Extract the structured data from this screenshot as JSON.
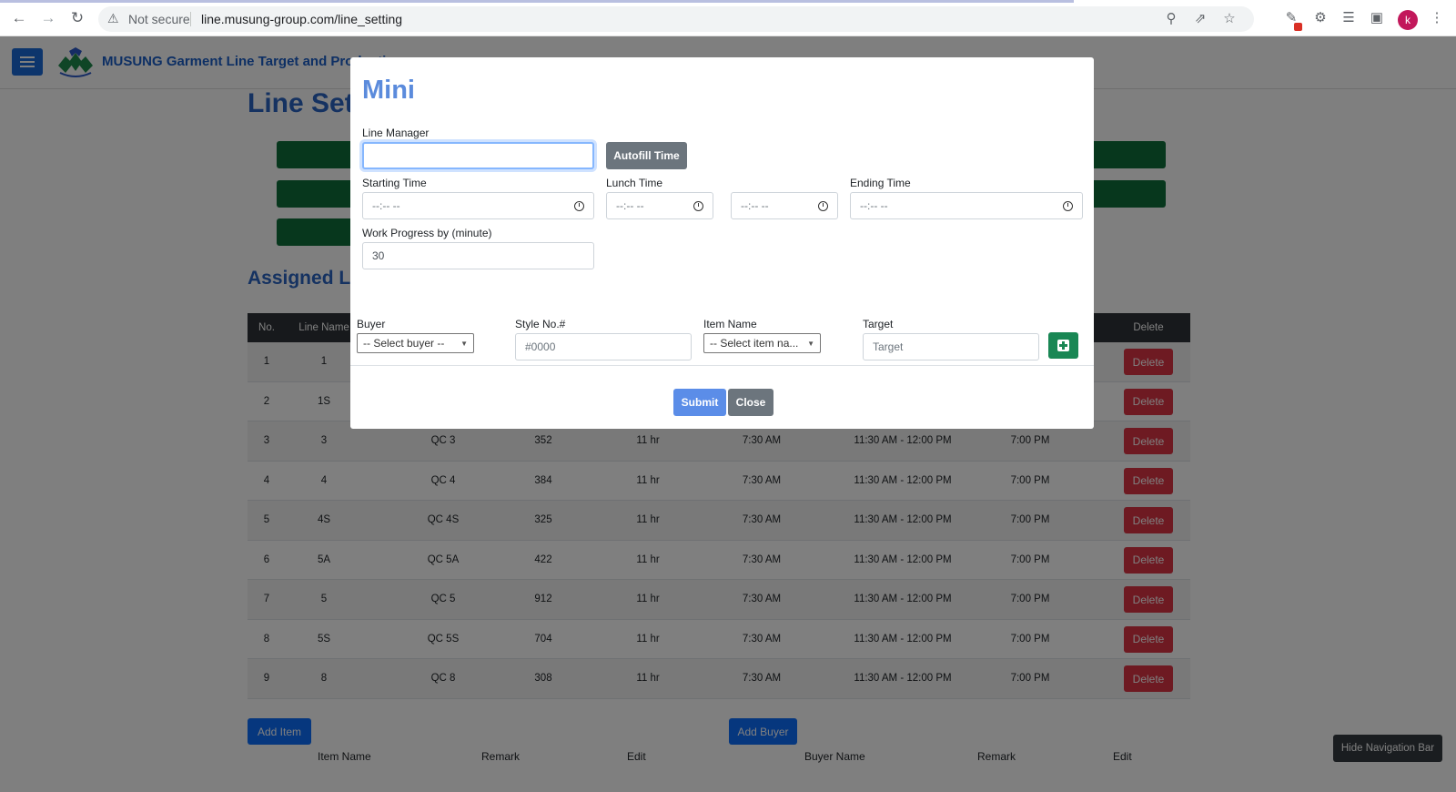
{
  "browser": {
    "security_label": "Not secure",
    "url": "line.musung-group.com/line_setting",
    "profile_initial": "k",
    "icons": [
      "back-icon",
      "forward-icon",
      "reload-icon",
      "warning-icon",
      "zoom-icon",
      "share-icon",
      "star-icon",
      "extension-alert-icon",
      "puzzle-icon",
      "reading-list-icon",
      "side-panel-icon",
      "kebab-menu-icon"
    ]
  },
  "app": {
    "title": "MUSUNG Garment Line Target and Production",
    "page_heading": "Line Setting",
    "assigned_heading": "Assigned Lines",
    "table": {
      "headers": [
        "No.",
        "Line Name",
        "",
        "",
        "",
        "",
        "",
        "",
        "Delete"
      ],
      "rows": [
        {
          "no": "1",
          "line": "1",
          "qc": "",
          "target": "",
          "hours": "",
          "start": "",
          "lunch": "",
          "end": "",
          "action": "Delete"
        },
        {
          "no": "2",
          "line": "1S",
          "qc": "",
          "target": "",
          "hours": "",
          "start": "",
          "lunch": "",
          "end": "",
          "action": "Delete"
        },
        {
          "no": "3",
          "line": "3",
          "qc": "QC 3",
          "target": "352",
          "hours": "11 hr",
          "start": "7:30 AM",
          "lunch": "11:30 AM - 12:00 PM",
          "end": "7:00 PM",
          "action": "Delete"
        },
        {
          "no": "4",
          "line": "4",
          "qc": "QC 4",
          "target": "384",
          "hours": "11 hr",
          "start": "7:30 AM",
          "lunch": "11:30 AM - 12:00 PM",
          "end": "7:00 PM",
          "action": "Delete"
        },
        {
          "no": "5",
          "line": "4S",
          "qc": "QC 4S",
          "target": "325",
          "hours": "11 hr",
          "start": "7:30 AM",
          "lunch": "11:30 AM - 12:00 PM",
          "end": "7:00 PM",
          "action": "Delete"
        },
        {
          "no": "6",
          "line": "5A",
          "qc": "QC 5A",
          "target": "422",
          "hours": "11 hr",
          "start": "7:30 AM",
          "lunch": "11:30 AM - 12:00 PM",
          "end": "7:00 PM",
          "action": "Delete"
        },
        {
          "no": "7",
          "line": "5",
          "qc": "QC 5",
          "target": "912",
          "hours": "11 hr",
          "start": "7:30 AM",
          "lunch": "11:30 AM - 12:00 PM",
          "end": "7:00 PM",
          "action": "Delete"
        },
        {
          "no": "8",
          "line": "5S",
          "qc": "QC 5S",
          "target": "704",
          "hours": "11 hr",
          "start": "7:30 AM",
          "lunch": "11:30 AM - 12:00 PM",
          "end": "7:00 PM",
          "action": "Delete"
        },
        {
          "no": "9",
          "line": "8",
          "qc": "QC 8",
          "target": "308",
          "hours": "11 hr",
          "start": "7:30 AM",
          "lunch": "11:30 AM - 12:00 PM",
          "end": "7:00 PM",
          "action": "Delete"
        }
      ]
    },
    "add_item_label": "Add Item",
    "add_buyer_label": "Add Buyer",
    "item_table_headers": [
      "Item Name",
      "Remark",
      "Edit"
    ],
    "buyer_table_headers": [
      "Buyer Name",
      "Remark",
      "Edit"
    ],
    "hide_nav_label": "Hide Navigation Bar"
  },
  "modal": {
    "title": "Mini",
    "line_manager_label": "Line Manager",
    "line_manager_value": "",
    "autofill_label": "Autofill Time",
    "starting_time_label": "Starting Time",
    "lunch_time_label": "Lunch Time",
    "ending_time_label": "Ending Time",
    "time_placeholder": "--:-- --",
    "work_progress_label": "Work Progress by (minute)",
    "work_progress_value": "30",
    "buyer_label": "Buyer",
    "buyer_selected": "-- Select buyer --",
    "style_label": "Style No.#",
    "style_placeholder": "#0000",
    "item_label": "Item Name",
    "item_selected": "-- Select item na...",
    "target_label": "Target",
    "target_placeholder": "Target",
    "submit_label": "Submit",
    "close_label": "Close"
  }
}
